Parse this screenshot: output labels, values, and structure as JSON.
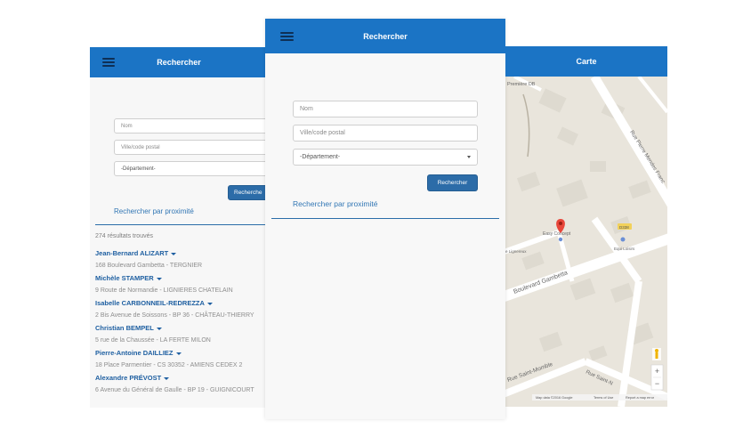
{
  "left_screen": {
    "title": "Rechercher",
    "name_placeholder": "Nom",
    "city_placeholder": "Ville/code postal",
    "department_selected": "-Département-",
    "search_button": "Recherche",
    "proximity_link": "Rechercher par proximité",
    "results_count": "274 résultats trouvés",
    "results": [
      {
        "name": "Jean-Bernard ALIZART",
        "address": "168 Boulevard Gambetta - TERGNIER"
      },
      {
        "name": "Michèle STAMPER",
        "address": "9 Route de Normandie - LIGNIERES CHATELAIN"
      },
      {
        "name": "Isabelle CARBONNEIL-REDREZZA",
        "address": "2 Bis Avenue de Soissons - BP 36 - CHÂTEAU-THIERRY"
      },
      {
        "name": "Christian BEMPEL",
        "address": "5 rue de la Chaussée - LA FERTE MILON"
      },
      {
        "name": "Pierre-Antoine DAILLIEZ",
        "address": "18 Place Parmentier - CS 30352 - AMIENS CEDEX 2"
      },
      {
        "name": "Alexandre PRÉVOST",
        "address": "6 Avenue du Général de Gaulle - BP 19 - GUIGNICOURT"
      }
    ]
  },
  "middle_screen": {
    "title": "Rechercher",
    "name_placeholder": "Nom",
    "city_placeholder": "Ville/code postal",
    "department_selected": "-Département-",
    "search_button": "Rechercher",
    "proximity_link": "Rechercher par proximité"
  },
  "right_screen": {
    "title": "Carte",
    "labels": {
      "premiere": "Première DB",
      "pierre_mendes": "Rue Pierre Mendes Franc",
      "easy_concept": "Easy Concept",
      "road_sign": "D338",
      "equi_loisirs": "Equi Loisirs",
      "lignereux": "e Lignereux",
      "boulevard_gambetta": "Boulevard Gambetta",
      "saint_momble": "Rue Saint-Momble",
      "saint_n": "Rue Saint-N"
    },
    "zoom_in": "+",
    "zoom_out": "−",
    "footer": {
      "map_data": "Map data ©2016 Google",
      "terms": "Terms of Use",
      "report": "Report a map error"
    }
  },
  "colors": {
    "appbar": "#1b74c5",
    "link": "#3176b4",
    "result_name": "#1e5fa1",
    "button": "#2c6ca8"
  }
}
